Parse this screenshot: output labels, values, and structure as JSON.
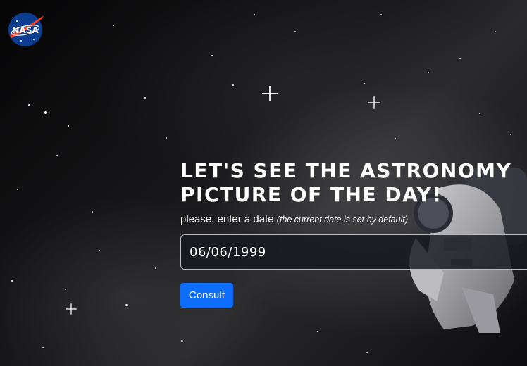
{
  "logo": {
    "text": "NASA",
    "icon": "nasa-meatball-logo"
  },
  "hero": {
    "title_line1": "LET'S SEE THE ASTRONOMY",
    "title_line2": "PICTURE OF THE DAY!",
    "instructions": "please, enter a date",
    "instructions_note": "(the current date is set by default)"
  },
  "form": {
    "date_value": "06/06/1999",
    "submit_label": "Consult"
  },
  "colors": {
    "primary_button": "#0d6efd",
    "logo_blue": "#0b3d91",
    "logo_red": "#fc3d21"
  }
}
